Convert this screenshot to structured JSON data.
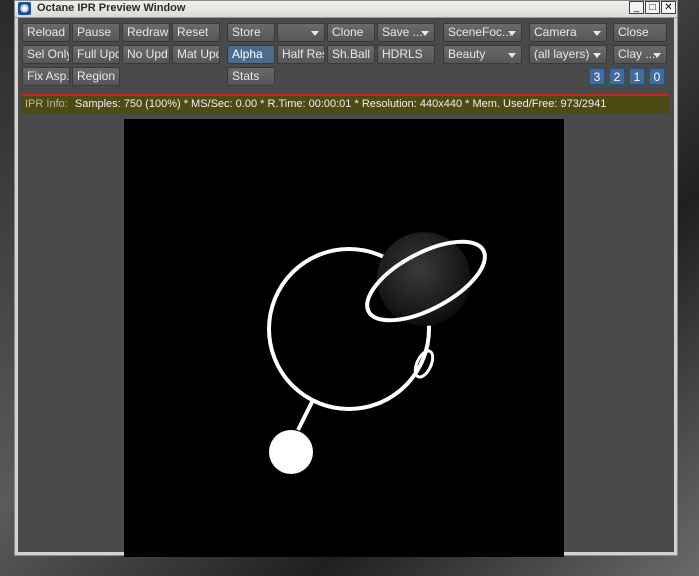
{
  "window": {
    "title": "Octane IPR Preview Window"
  },
  "titlebar_buttons": {
    "minimize": "_",
    "maximize": "□",
    "close": "✕"
  },
  "toolbar_row1": {
    "reload": "Reload",
    "pause": "Pause",
    "redraw": "Redraw",
    "reset": "Reset",
    "store": "Store",
    "store_slot": "",
    "clone": "Clone",
    "save": "Save ...",
    "scene": "SceneFoc...",
    "camera": "Camera",
    "close": "Close"
  },
  "toolbar_row2": {
    "sel_only": "Sel Only",
    "full_upd": "Full Upd.",
    "no_upd": "No Upd.",
    "mat_upd": "Mat Upd",
    "alpha": "Alpha",
    "half_res": "Half Res",
    "sh_ball": "Sh.Ball",
    "hdrls": "HDRLS",
    "beauty": "Beauty",
    "layers": "(all layers)",
    "clay": "Clay ..."
  },
  "toolbar_row3": {
    "fix_asp": "Fix Asp.",
    "region": "Region",
    "stats": "Stats",
    "num_buttons": [
      "3",
      "2",
      "1",
      "0"
    ]
  },
  "ipr_info": {
    "label": "IPR Info:",
    "text": "Samples: 750 (100%)  *  MS/Sec: 0.00  *  R.Time: 00:00:01  *  Resolution: 440x440  *  Mem. Used/Free: 973/2941"
  },
  "colors": {
    "active_button": "#4d6a8f",
    "info_bar": "#4e4a14",
    "info_border": "#c82323",
    "num_buttons": "#3f6b9d"
  }
}
